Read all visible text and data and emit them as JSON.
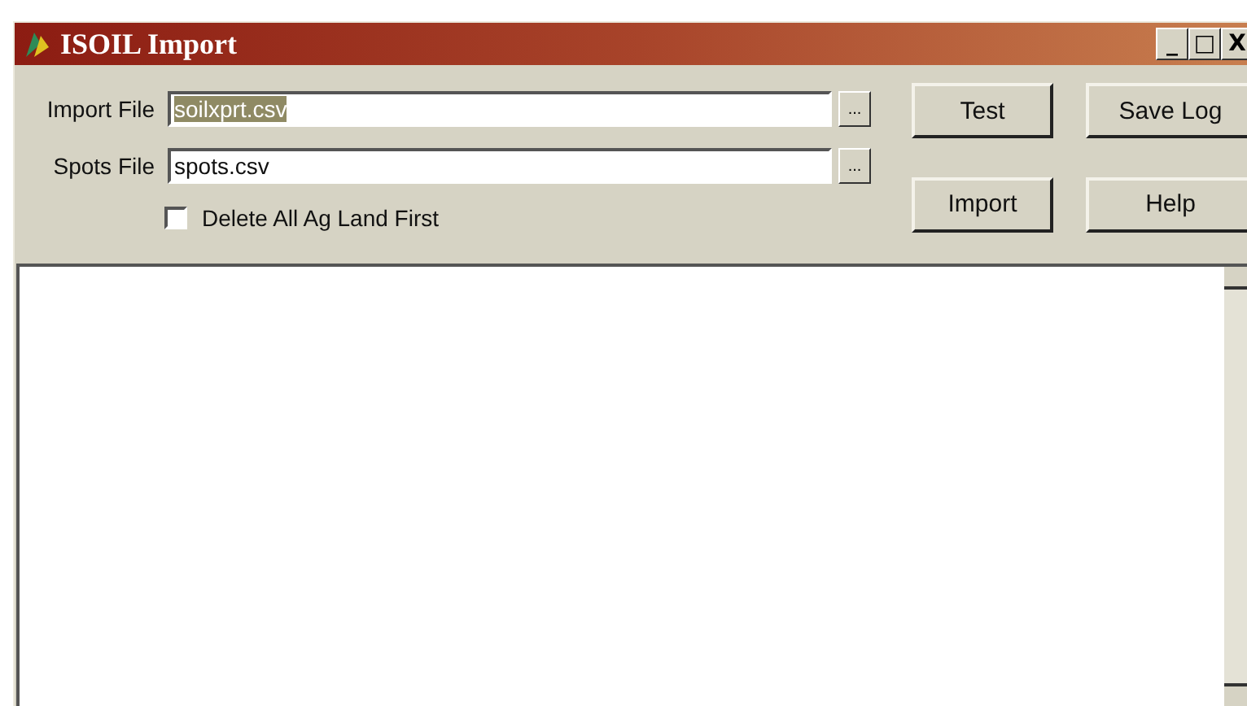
{
  "window": {
    "title": "ISOIL Import",
    "controls": [
      "_",
      "□",
      "X"
    ]
  },
  "file_fields": [
    {
      "label": "Import File",
      "value": "soilxprt.csv",
      "selected": true,
      "browse": "..."
    },
    {
      "label": "Spots File",
      "value": "spots.csv",
      "selected": false,
      "browse": "..."
    }
  ],
  "buttons": [
    [
      "Test",
      "Save Log"
    ],
    [
      "Import",
      "Help"
    ]
  ],
  "checkbox": {
    "label": "Delete All Ag Land First",
    "checked": false
  }
}
